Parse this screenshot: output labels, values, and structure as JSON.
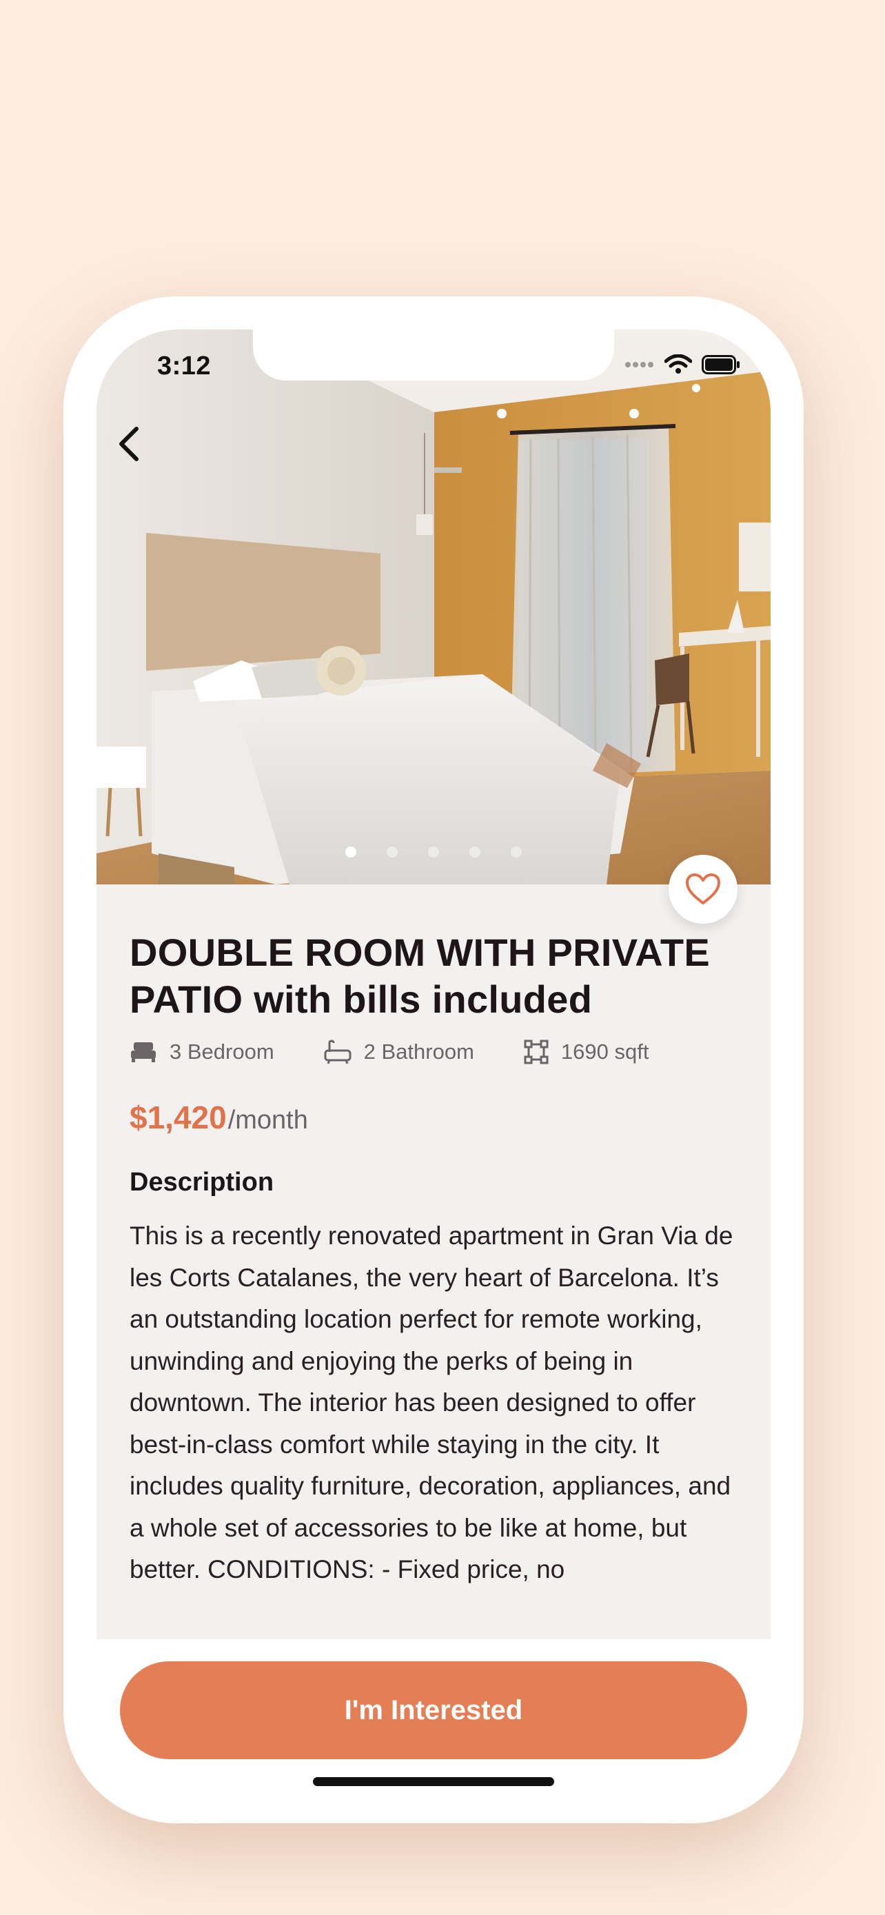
{
  "status_bar": {
    "time": "3:12"
  },
  "listing": {
    "title": "DOUBLE ROOM WITH PRIVATE PATIO with bills included",
    "features": [
      {
        "icon": "bed-icon",
        "label": "3 Bedroom"
      },
      {
        "icon": "bathtub-icon",
        "label": "2 Bathroom"
      },
      {
        "icon": "area-icon",
        "label": "1690 sqft"
      }
    ],
    "price": "$1,420",
    "period": "/month",
    "description_heading": "Description",
    "description": "This is a recently renovated apartment in Gran Via de les Corts Catalanes, the very heart of Barcelona. It’s an outstanding location perfect for remote working, unwinding and enjoying the perks of being in downtown. The interior has been designed to offer best-in-class comfort while staying in the city. It includes quality furniture, decoration, appliances, and a whole set of accessories to be like at home, but better. CONDITIONS: - Fixed price, no"
  },
  "gallery": {
    "photo_count": 5,
    "active_index": 0
  },
  "cta": {
    "label": "I'm Interested"
  },
  "colors": {
    "accent": "#E47E55",
    "price": "#E0724C",
    "background": "#FDECE0"
  }
}
